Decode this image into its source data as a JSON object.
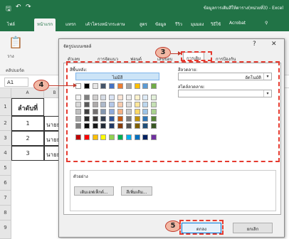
{
  "titlebar": {
    "document_title": "ข้อมูลการเติมสีให้ตาราง(หน่วยที่3) - Excel",
    "colors": {
      "bar": "#217346"
    }
  },
  "ribbon": {
    "tabs": [
      {
        "label": "ไฟล์"
      },
      {
        "label": "หน้าแรก"
      },
      {
        "label": "แทรก"
      },
      {
        "label": "เค้าโครงหน้ากระดาษ"
      },
      {
        "label": "สูตร"
      },
      {
        "label": "ข้อมูล"
      },
      {
        "label": "รีวิว"
      },
      {
        "label": "มุมมอง"
      },
      {
        "label": "วิธีใช้"
      },
      {
        "label": "Acrobat"
      }
    ],
    "clipboard_label": "คลิปบอร์ด",
    "paste_label": "วาง"
  },
  "formula_bar": {
    "name_box": "A1"
  },
  "sheet": {
    "column_headers": [
      "A",
      "B"
    ],
    "row_numbers": [
      "1",
      "2",
      "3",
      "4",
      "5",
      "6",
      "7",
      "8",
      "9"
    ],
    "cells": [
      {
        "a": "ลำดับที่",
        "b": ""
      },
      {
        "a": "1",
        "b": "นายธ"
      },
      {
        "a": "2",
        "b": "นายธ"
      },
      {
        "a": "3",
        "b": "นายธ"
      }
    ]
  },
  "dialog": {
    "title": "จัดรูปแบบเซลล์",
    "help": "?",
    "close": "✕",
    "tabs": [
      {
        "label": "ตัวเลข"
      },
      {
        "label": "การจัดแนว"
      },
      {
        "label": "ฟอนต์"
      },
      {
        "label": "เส้นขอบ"
      },
      {
        "label": "การเติม",
        "active": true
      },
      {
        "label": "การป้องกัน"
      }
    ],
    "fill": {
      "bg_color_label": "สีพื้นหลัง:",
      "no_color": "ไม่มีสี",
      "fill_effects_button": "เติมเอฟเฟ็กต์...",
      "more_colors_button": "สีเพิ่มเติม...",
      "pattern_color_label": "สีลวดลาย:",
      "pattern_color_value": "อัตโนมัติ",
      "pattern_style_label": "สไตล์ลวดลาย:",
      "pattern_style_value": "",
      "sample_label": "ตัวอย่าง"
    },
    "ok": "ตกลง",
    "cancel": "ยกเลิก"
  },
  "palette": {
    "theme_row_1": [
      "#ffffff",
      "#000000",
      "#e7e6e6",
      "#44546a",
      "#4472c4",
      "#ed7d31",
      "#a5a5a5",
      "#ffc000",
      "#5b9bd5",
      "#70ad47"
    ],
    "tints": [
      [
        "#f2f2f2",
        "#808080",
        "#d0cece",
        "#d6dce5",
        "#dae3f3",
        "#fbe5d6",
        "#ededed",
        "#fff2cc",
        "#deebf7",
        "#e2f0d9"
      ],
      [
        "#d9d9d9",
        "#595959",
        "#aeabab",
        "#adb9ca",
        "#b4c7e7",
        "#f8cbad",
        "#dbdbdb",
        "#ffe699",
        "#bdd7ee",
        "#c5e0b4"
      ],
      [
        "#bfbfbf",
        "#404040",
        "#757171",
        "#8497b0",
        "#8faadc",
        "#f4b183",
        "#c9c9c9",
        "#ffd966",
        "#9dc3e6",
        "#a9d18e"
      ],
      [
        "#a6a6a6",
        "#262626",
        "#3b3838",
        "#333f50",
        "#2f5597",
        "#c55a11",
        "#7b7b7b",
        "#bf9000",
        "#2e75b6",
        "#548235"
      ],
      [
        "#7f7f7f",
        "#0d0d0d",
        "#171616",
        "#222a35",
        "#203864",
        "#843c0c",
        "#525252",
        "#7f6000",
        "#1f4e79",
        "#385723"
      ]
    ],
    "standard": [
      "#c00000",
      "#ff0000",
      "#ffc000",
      "#ffff00",
      "#92d050",
      "#00b050",
      "#00b0f0",
      "#0070c0",
      "#002060",
      "#7030a0"
    ]
  },
  "annotations": [
    {
      "number": "3"
    },
    {
      "number": "4"
    },
    {
      "number": "5"
    }
  ]
}
